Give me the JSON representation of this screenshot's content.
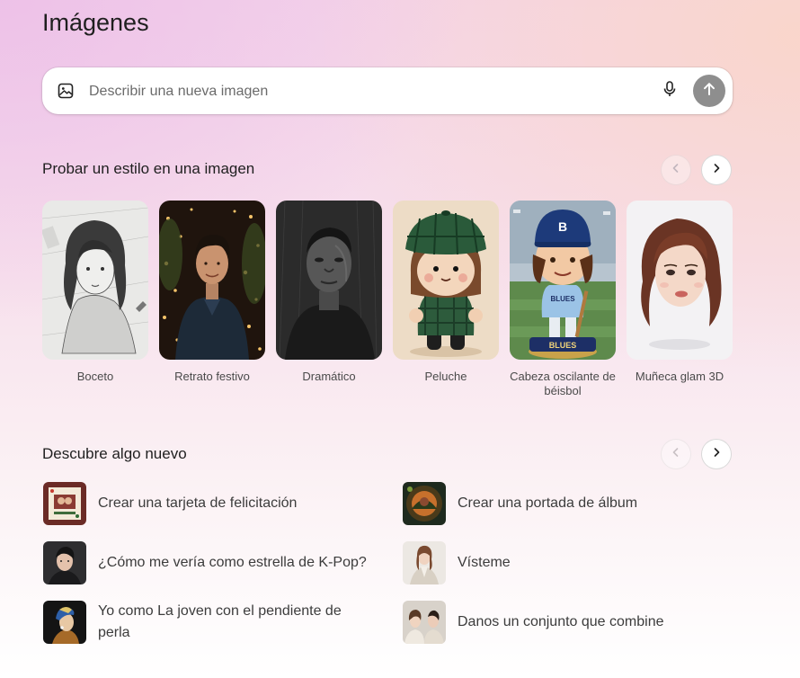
{
  "page": {
    "title": "Imágenes"
  },
  "prompt": {
    "placeholder": "Describir una nueva imagen",
    "icons": {
      "left": "image-icon",
      "mic": "mic-icon",
      "send": "arrow-up-icon"
    }
  },
  "styles_section": {
    "title": "Probar un estilo en una imagen",
    "items": [
      {
        "label": "Boceto",
        "icon": "sketch-portrait"
      },
      {
        "label": "Retrato festivo",
        "icon": "festive-portrait"
      },
      {
        "label": "Dramático",
        "icon": "dramatic-portrait"
      },
      {
        "label": "Peluche",
        "icon": "plush-doll"
      },
      {
        "label": "Cabeza oscilante de béisbol",
        "icon": "baseball-bobblehead",
        "badge_text": "BLUES",
        "cap_letter": "B"
      },
      {
        "label": "Muñeca glam 3D",
        "icon": "glam-doll-3d"
      }
    ]
  },
  "discover_section": {
    "title": "Descubre algo nuevo",
    "items": [
      {
        "label": "Crear una tarjeta de felicitación",
        "icon": "greeting-card-thumb"
      },
      {
        "label": "Crear una portada de álbum",
        "icon": "album-cover-thumb"
      },
      {
        "label": "¿Cómo me vería como estrella de K-Pop?",
        "icon": "kpop-star-thumb"
      },
      {
        "label": "Vísteme",
        "icon": "fashion-thumb"
      },
      {
        "label": "Yo como La joven con el pendiente de perla",
        "icon": "pearl-earring-thumb"
      },
      {
        "label": "Danos un conjunto que combine",
        "icon": "matching-outfit-thumb"
      }
    ]
  },
  "colors": {
    "send_button": "#8e8e8e",
    "text_primary": "#1f1f1f",
    "text_secondary": "#4a4a4a"
  }
}
